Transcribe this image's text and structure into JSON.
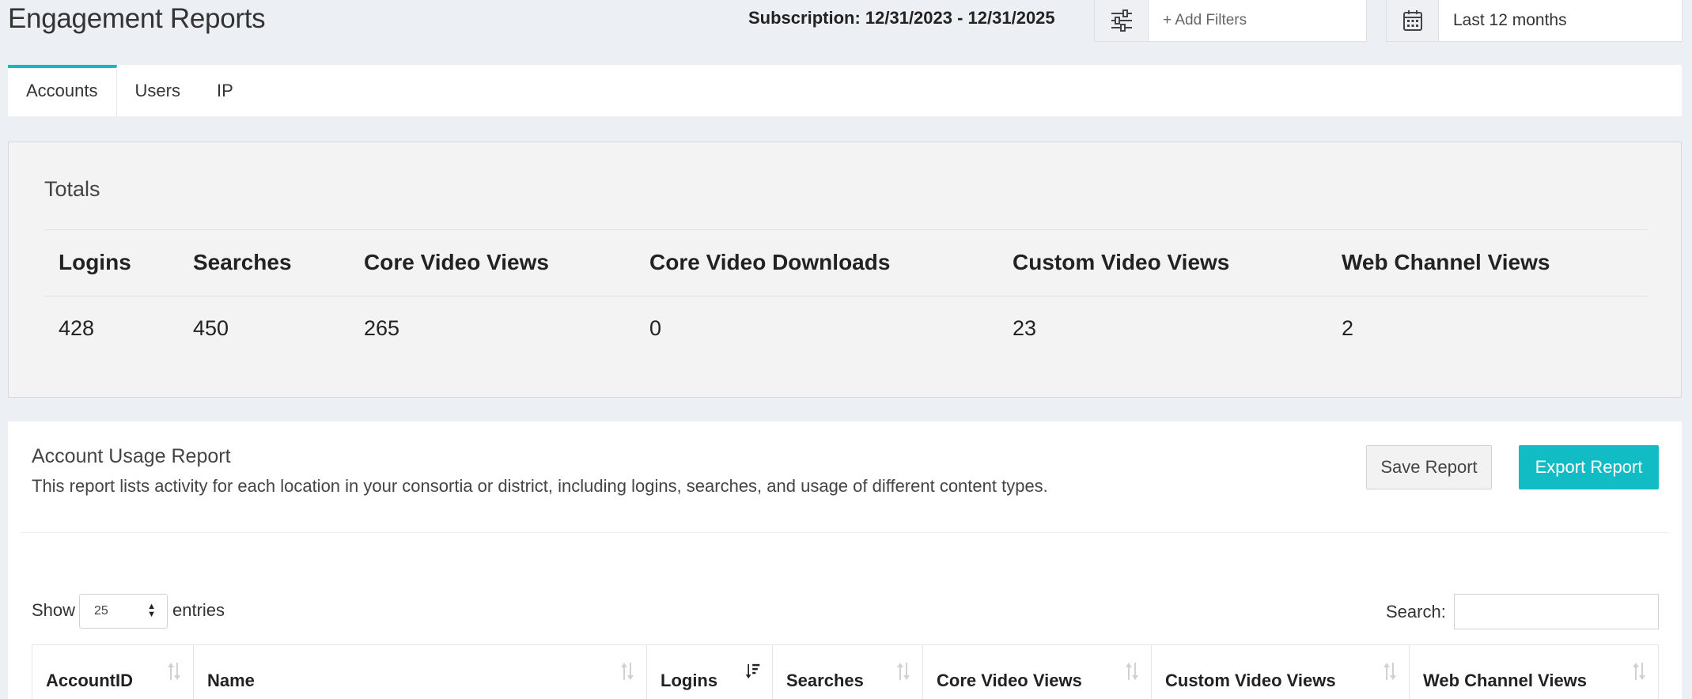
{
  "header": {
    "title": "Engagement Reports",
    "subscription": "Subscription: 12/31/2023 - 12/31/2025",
    "filter_placeholder": "+ Add Filters",
    "date_range": "Last 12 months"
  },
  "tabs": [
    {
      "label": "Accounts",
      "active": true
    },
    {
      "label": "Users",
      "active": false
    },
    {
      "label": "IP",
      "active": false
    }
  ],
  "totals": {
    "title": "Totals",
    "columns": [
      "Logins",
      "Searches",
      "Core Video Views",
      "Core Video Downloads",
      "Custom Video Views",
      "Web Channel Views"
    ],
    "values": [
      "428",
      "450",
      "265",
      "0",
      "23",
      "2"
    ]
  },
  "report": {
    "title": "Account Usage Report",
    "description": "This report lists activity for each location in your consortia or district, including logins, searches, and usage of different content types.",
    "save_label": "Save Report",
    "export_label": "Export Report",
    "show_label": "Show",
    "entries_value": "25",
    "entries_label": "entries",
    "search_label": "Search:",
    "table_headers": [
      "AccountID",
      "Name",
      "Logins",
      "Searches",
      "Core Video Views",
      "Custom Video Views",
      "Web Channel Views"
    ]
  },
  "colors": {
    "accent": "#12bcc4",
    "background": "#eceff3"
  }
}
